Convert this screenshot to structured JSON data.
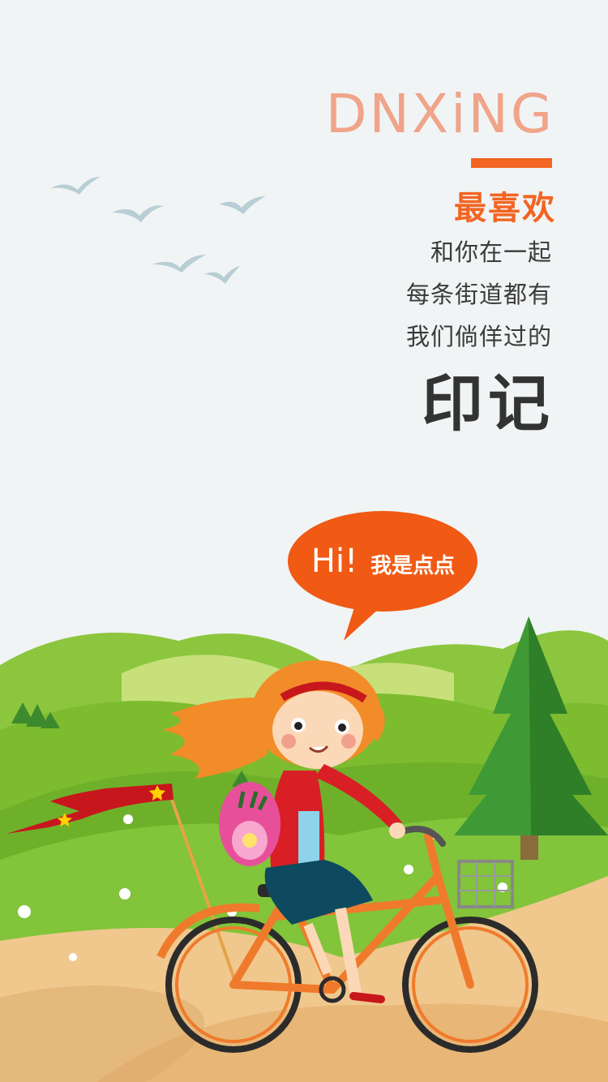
{
  "brand": {
    "name": "DNXiNG",
    "accent_color": "#f26522",
    "name_color": "#f0a48a"
  },
  "tagline": {
    "headline": "最喜欢",
    "lines": [
      "和你在一起",
      "每条街道都有",
      "我们倘佯过的"
    ],
    "emphasis": "印记"
  },
  "speech_bubble": {
    "greeting": "Hi!",
    "text": "我是点点"
  },
  "illustration": {
    "subject": "girl-riding-bicycle",
    "elements": [
      "birds",
      "green-hills",
      "pine-tree",
      "red-pennant-flag",
      "basket",
      "flowers",
      "dirt-path"
    ]
  }
}
